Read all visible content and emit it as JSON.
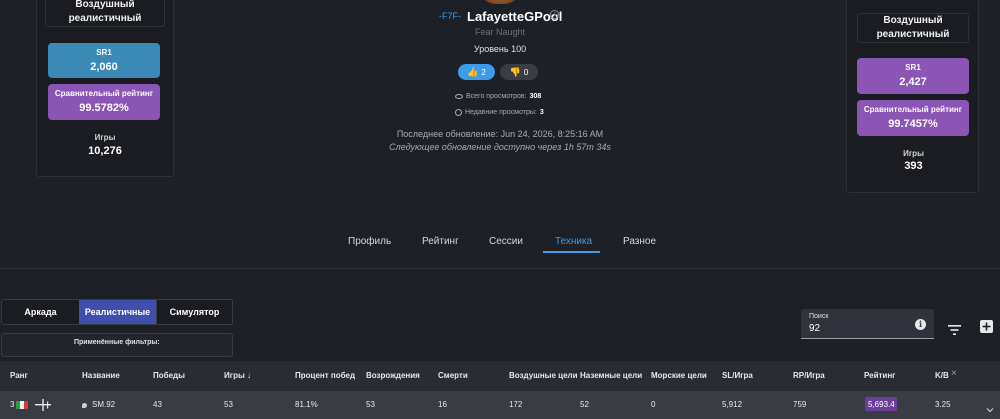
{
  "left_card": {
    "mode": "Воздушный реалистичный",
    "sr1_label": "SR1",
    "sr1_value": "2,060",
    "rating_label": "Сравнительный рейтинг",
    "rating_value": "99.5782%",
    "games_label": "Игры",
    "games_value": "10,276"
  },
  "right_card": {
    "mode": "Воздушный реалистичный",
    "sr1_label": "SR1",
    "sr1_value": "2,427",
    "rating_label": "Сравнительный рейтинг",
    "rating_value": "99.7457%",
    "games_label": "Игры",
    "games_value": "393"
  },
  "profile": {
    "clan_tag": "-F7F-",
    "username": "LafayetteGPool",
    "title": "Fear Naught",
    "level": "Уровень 100",
    "likes": "2",
    "dislikes": "0",
    "total_views_label": "Всего просмотров:",
    "total_views": "308",
    "recent_views_label": "Недавние просмотры:",
    "recent_views": "3",
    "last_update": "Последнее обновление: Jun 24, 2026, 8:25:16 AM",
    "next_update": "Следующее обновление доступно через 1h 57m 34s"
  },
  "tabs": [
    "Профиль",
    "Рейтинг",
    "Сессии",
    "Техника",
    "Разное"
  ],
  "active_tab": 3,
  "modes": [
    "Аркада",
    "Реалистичные",
    "Симулятор"
  ],
  "active_mode": 1,
  "applied_filters_label": "Применённые фильтры:",
  "search": {
    "label": "Поиск",
    "value": "92"
  },
  "table": {
    "headers": [
      "Ранг",
      "Название",
      "Победы",
      "Игры ↓",
      "Процент побед",
      "Возрождения",
      "Смерти",
      "Воздушные цели",
      "Наземные цели",
      "Морские цели",
      "SL/Игра",
      "RP/Игра",
      "Рейтинг",
      "K/B"
    ],
    "close_symbol": "×",
    "row": {
      "rank": "3",
      "name": "SM.92",
      "wins": "43",
      "games": "53",
      "win_rate": "81.1%",
      "respawns": "53",
      "deaths": "16",
      "air_targets": "172",
      "ground_targets": "52",
      "naval_targets": "0",
      "sl_per_game": "5,912",
      "rp_per_game": "759",
      "rating": "5,693.4",
      "kd": "3.25"
    }
  },
  "colors": {
    "accent_blue": "#3d9ce8",
    "sr_teal": "#3b8ab5",
    "rating_purple": "#8a55b4"
  }
}
